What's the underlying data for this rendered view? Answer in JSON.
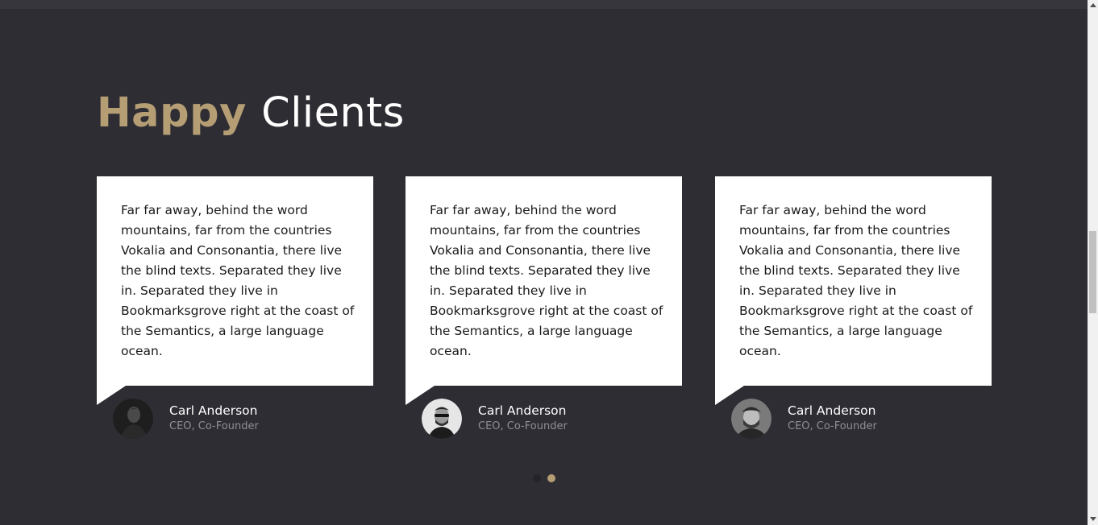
{
  "section": {
    "title_accent": "Happy",
    "title_rest": "Clients",
    "accent_color": "#b59d74",
    "background_color": "#2d2d33"
  },
  "testimonials": [
    {
      "quote": "Far far away, behind the word mountains, far from the countries Vokalia and Consonantia, there live the blind texts. Separated they live in. Separated they live in Bookmarksgrove right at the coast of the Semantics, a large language ocean.",
      "name": "Carl Anderson",
      "role": "CEO, Co-Founder",
      "avatar": "person-1"
    },
    {
      "quote": "Far far away, behind the word mountains, far from the countries Vokalia and Consonantia, there live the blind texts. Separated they live in. Separated they live in Bookmarksgrove right at the coast of the Semantics, a large language ocean.",
      "name": "Carl Anderson",
      "role": "CEO, Co-Founder",
      "avatar": "person-2"
    },
    {
      "quote": "Far far away, behind the word mountains, far from the countries Vokalia and Consonantia, there live the blind texts. Separated they live in. Separated they live in Bookmarksgrove right at the coast of the Semantics, a large language ocean.",
      "name": "Carl Anderson",
      "role": "CEO, Co-Founder",
      "avatar": "person-3"
    }
  ],
  "carousel": {
    "page_count": 2,
    "active_page": 2
  }
}
